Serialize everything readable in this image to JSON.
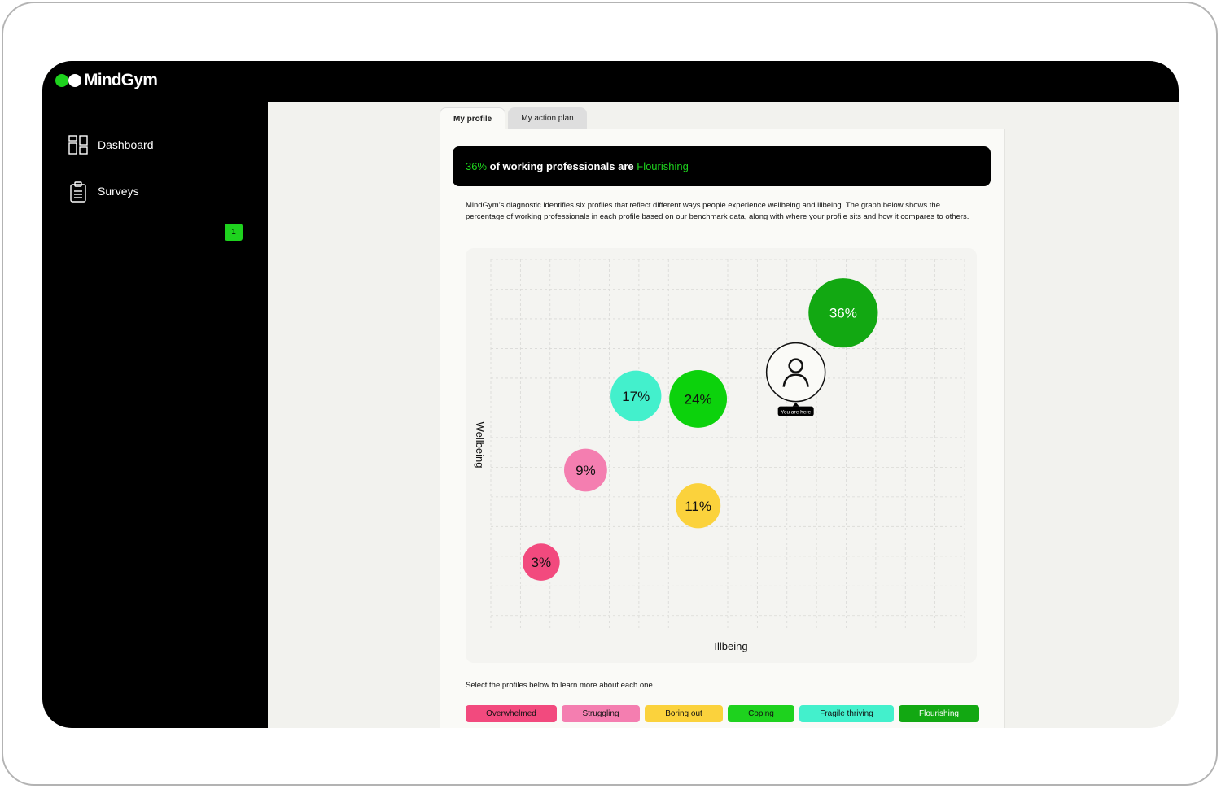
{
  "app": {
    "logo_text": "MindGym"
  },
  "sidebar": {
    "items": [
      {
        "label": "Dashboard",
        "icon": "dashboard-icon"
      },
      {
        "label": "Surveys",
        "icon": "clipboard-icon",
        "badge": "1"
      }
    ],
    "collapse_icon": "collapse-sidebar-icon"
  },
  "tabs": [
    {
      "label": "My profile",
      "active": true
    },
    {
      "label": "My action plan",
      "active": false
    }
  ],
  "banner": {
    "pct": "36%",
    "mid": " of working professionals are ",
    "profile": "Flourishing"
  },
  "description": "MindGym’s diagnostic identifies six profiles that reflect different ways people experience wellbeing and illbeing. The graph below shows the percentage of working professionals in each profile based on our benchmark data, along with where your profile sits and how it compares to others.",
  "select_prompt": "Select the profiles below to learn more about each one.",
  "profiles": [
    {
      "label": "Overwhelmed",
      "color": "#f24a7e"
    },
    {
      "label": "Struggling",
      "color": "#f47eb0"
    },
    {
      "label": "Boring out",
      "color": "#fbd23c"
    },
    {
      "label": "Coping",
      "color": "#1ed21e"
    },
    {
      "label": "Fragile thriving",
      "color": "#43f0cc"
    },
    {
      "label": "Flourishing",
      "color": "#12a812"
    }
  ],
  "chart_data": {
    "type": "bubble",
    "xlabel": "Illbeing",
    "ylabel": "Wellbeing",
    "grid": true,
    "points": [
      {
        "label": "3%",
        "value": 3,
        "profile": "Overwhelmed",
        "x": 1.7,
        "y": 2.3,
        "color": "#f24a7e"
      },
      {
        "label": "9%",
        "value": 9,
        "profile": "Struggling",
        "x": 3.2,
        "y": 5.4,
        "color": "#f47eb0"
      },
      {
        "label": "11%",
        "value": 11,
        "profile": "Boring out",
        "x": 7.0,
        "y": 4.2,
        "color": "#fbd23c"
      },
      {
        "label": "24%",
        "value": 24,
        "profile": "Coping",
        "x": 7.0,
        "y": 7.8,
        "color": "#0cd20c"
      },
      {
        "label": "17%",
        "value": 17,
        "profile": "Fragile thriving",
        "x": 4.9,
        "y": 7.9,
        "color": "#43f0cc"
      },
      {
        "label": "36%",
        "value": 36,
        "profile": "Flourishing",
        "x": 11.9,
        "y": 10.7,
        "color": "#12a812"
      }
    ],
    "marker": {
      "label": "You are here",
      "x": 10.3,
      "y": 8.7
    },
    "xlim": [
      0,
      16
    ],
    "ylim": [
      0,
      12.5
    ]
  }
}
